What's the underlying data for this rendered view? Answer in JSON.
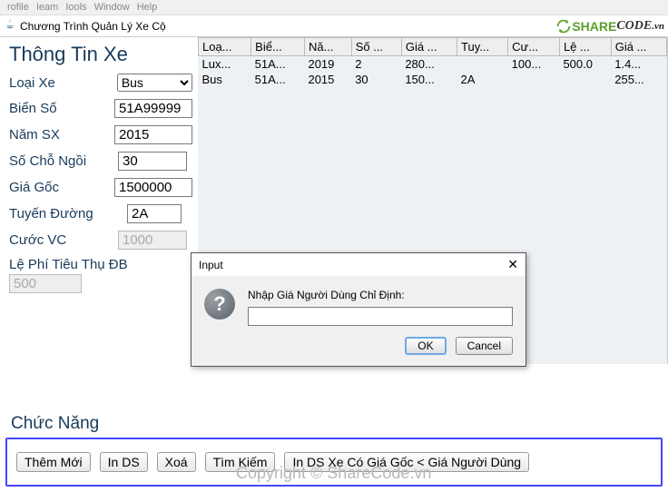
{
  "menubar": {
    "items": [
      "rofile",
      "Ieam",
      "Iools",
      "Window",
      "Help"
    ]
  },
  "window": {
    "title": "Chương Trình Quản Lý Xe Cộ"
  },
  "logo": {
    "share": "SHARE",
    "code": "CODE",
    "vn": ".vn"
  },
  "info_panel": {
    "heading": "Thông Tin Xe",
    "loai_xe_label": "Loại Xe",
    "loai_xe_value": "Bus",
    "bien_so_label": "Biển Số",
    "bien_so_value": "51A99999",
    "nam_sx_label": "Năm SX",
    "nam_sx_value": "2015",
    "so_cho_label": "Số Chỗ Ngồi",
    "so_cho_value": "30",
    "gia_goc_label": "Giá Gốc",
    "gia_goc_value": "1500000",
    "tuyen_label": "Tuyến Đường",
    "tuyen_value": "2A",
    "cuoc_label": "Cước VC",
    "cuoc_value": "1000",
    "lephi_label": "Lệ Phí Tiêu Thụ ĐB",
    "lephi_value": "500"
  },
  "table": {
    "headers": [
      "Loạ...",
      "Biể...",
      "Nă...",
      "Số ...",
      "Giá ...",
      "Tuy...",
      "Cư...",
      "Lệ ...",
      "Giá ..."
    ],
    "rows": [
      [
        "Lux...",
        "51A...",
        "2019",
        "2",
        "280...",
        "",
        "100...",
        "500.0",
        "1.4..."
      ],
      [
        "Bus",
        "51A...",
        "2015",
        "30",
        "150...",
        "2A",
        "",
        "",
        "255..."
      ]
    ]
  },
  "functions": {
    "heading": "Chức Năng",
    "them_moi": "Thêm Mới",
    "in_ds": "In DS",
    "xoa": "Xoá",
    "tim_kiem": "Tìm Kiếm",
    "in_ds_gia": "In DS Xe Có Giá Gốc < Giá Người Dùng"
  },
  "dialog": {
    "title": "Input",
    "prompt": "Nhập Giá Người Dùng Chỉ Định:",
    "value": "",
    "ok": "OK",
    "cancel": "Cancel"
  },
  "watermark": {
    "w1": "ShareCode.vn",
    "w2": "Copyright © ShareCode.vn"
  }
}
